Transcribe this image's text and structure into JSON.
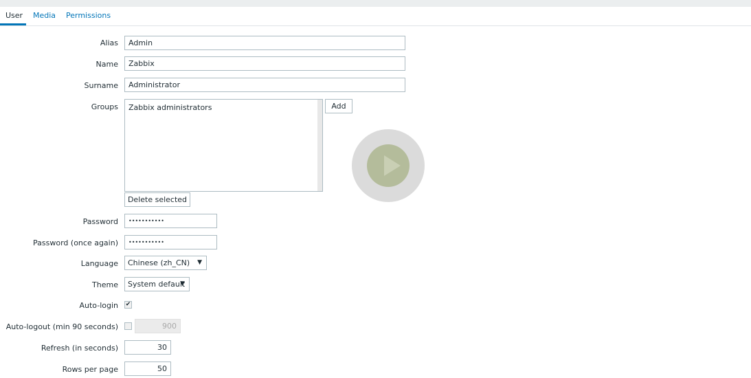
{
  "tabs": [
    {
      "label": "User"
    },
    {
      "label": "Media"
    },
    {
      "label": "Permissions"
    }
  ],
  "form": {
    "alias": {
      "label": "Alias",
      "value": "Admin"
    },
    "name": {
      "label": "Name",
      "value": "Zabbix"
    },
    "surname": {
      "label": "Surname",
      "value": "Administrator"
    },
    "groups": {
      "label": "Groups",
      "items": [
        "Zabbix administrators"
      ],
      "add_label": "Add",
      "delete_label": "Delete selected"
    },
    "password": {
      "label": "Password",
      "value": "•••••••••••"
    },
    "password2": {
      "label": "Password (once again)",
      "value": "•••••••••••"
    },
    "language": {
      "label": "Language",
      "value": "Chinese (zh_CN)"
    },
    "theme": {
      "label": "Theme",
      "value": "System default"
    },
    "autologin": {
      "label": "Auto-login",
      "checked": true
    },
    "autologout": {
      "label": "Auto-logout (min 90 seconds)",
      "checked": false,
      "value": "900"
    },
    "refresh": {
      "label": "Refresh (in seconds)",
      "value": "30"
    },
    "rows": {
      "label": "Rows per page",
      "value": "50"
    }
  },
  "colors": {
    "accent": "#0275b8"
  }
}
